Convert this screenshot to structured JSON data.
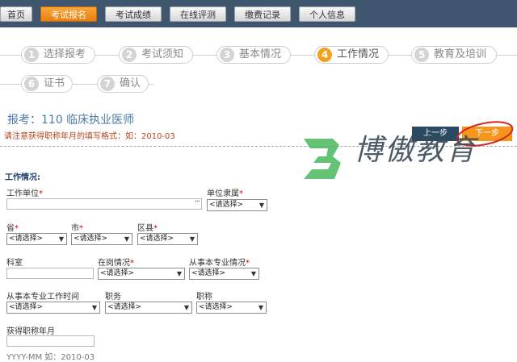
{
  "nav": {
    "home": "首页",
    "signup": "考试报名",
    "scores": "考试成绩",
    "online_test": "在线评测",
    "payment": "缴费记录",
    "profile": "个人信息"
  },
  "steps": [
    {
      "num": "1",
      "label": "选择报考"
    },
    {
      "num": "2",
      "label": "考试须知"
    },
    {
      "num": "3",
      "label": "基本情况"
    },
    {
      "num": "4",
      "label": "工作情况"
    },
    {
      "num": "5",
      "label": "教育及培训"
    },
    {
      "num": "6",
      "label": "证书"
    },
    {
      "num": "7",
      "label": "确认"
    }
  ],
  "exam": {
    "title": "报考：110 临床执业医师",
    "hint": "请注意获得职称年月的填写格式：如：2010-03"
  },
  "buttons": {
    "prev": "上一步",
    "next": "下一步"
  },
  "watermark": {
    "text": "博傲教育",
    "logo_color": "#49b85c"
  },
  "form": {
    "section_title": "工作情况:",
    "work_unit": {
      "label": "工作单位",
      "value": "",
      "picker": "···"
    },
    "unit_affiliation": {
      "label": "单位隶属",
      "value": "<请选择>"
    },
    "province": {
      "label": "省",
      "value": "<请选择>"
    },
    "city": {
      "label": "市",
      "value": "<请选择>"
    },
    "district": {
      "label": "区县",
      "value": "<请选择>"
    },
    "department": {
      "label": "科室",
      "value": ""
    },
    "on_duty": {
      "label": "在岗情况",
      "value": "<请选择>"
    },
    "major_situation": {
      "label": "从事本专业情况",
      "value": "<请选择>"
    },
    "major_time": {
      "label": "从事本专业工作时间",
      "value": "<请选择>"
    },
    "position": {
      "label": "职务",
      "value": "<请选择>"
    },
    "title_rank": {
      "label": "职称",
      "value": "<请选择>"
    },
    "title_date": {
      "label": "获得职称年月",
      "value": "",
      "format": "YYYY-MM 如：2010-03"
    }
  },
  "colors": {
    "nav_bg": "#3d566d",
    "accent": "#f4961c",
    "required": "#dd0000",
    "link_blue": "#4b7ba8"
  }
}
